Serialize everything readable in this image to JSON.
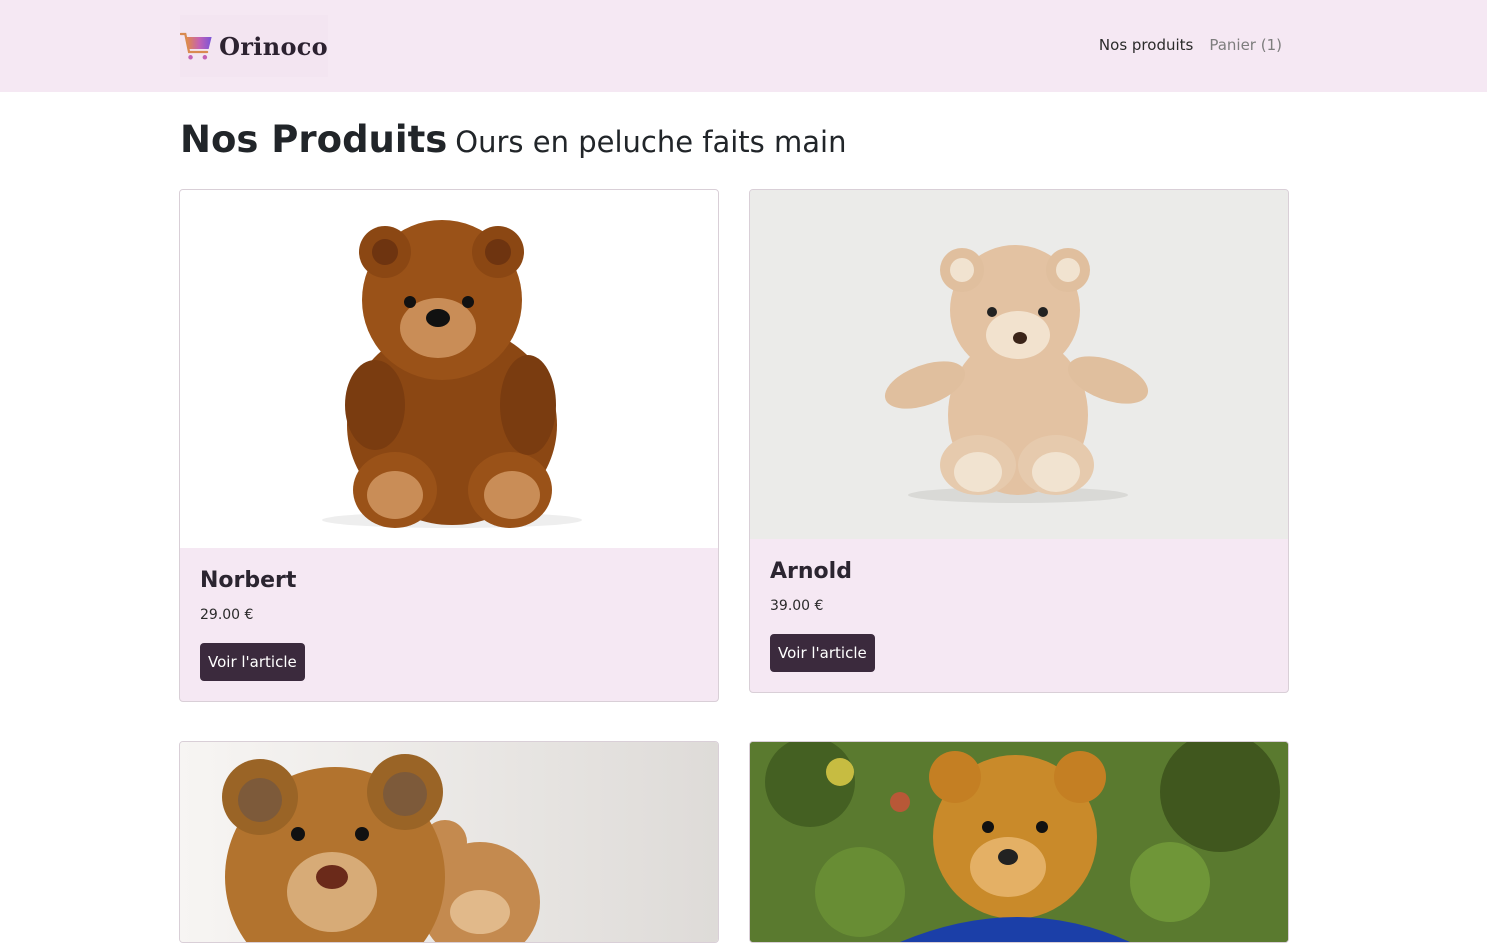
{
  "navbar": {
    "brand": "Orinoco",
    "links": [
      {
        "label": "Nos produits"
      },
      {
        "label": "Panier (1)"
      }
    ]
  },
  "page": {
    "title": "Nos Produits",
    "subtitle": "Ours en peluche faits main"
  },
  "products": [
    {
      "name": "Norbert",
      "price": "29.00 €",
      "button": "Voir l'article"
    },
    {
      "name": "Arnold",
      "price": "39.00 €",
      "button": "Voir l'article"
    },
    {
      "name": "",
      "price": "",
      "button": ""
    },
    {
      "name": "",
      "price": "",
      "button": ""
    }
  ],
  "colors": {
    "navbar_bg": "#f5e8f3",
    "card_bg": "#f5e8f3",
    "button_bg": "#3b2a3d"
  }
}
